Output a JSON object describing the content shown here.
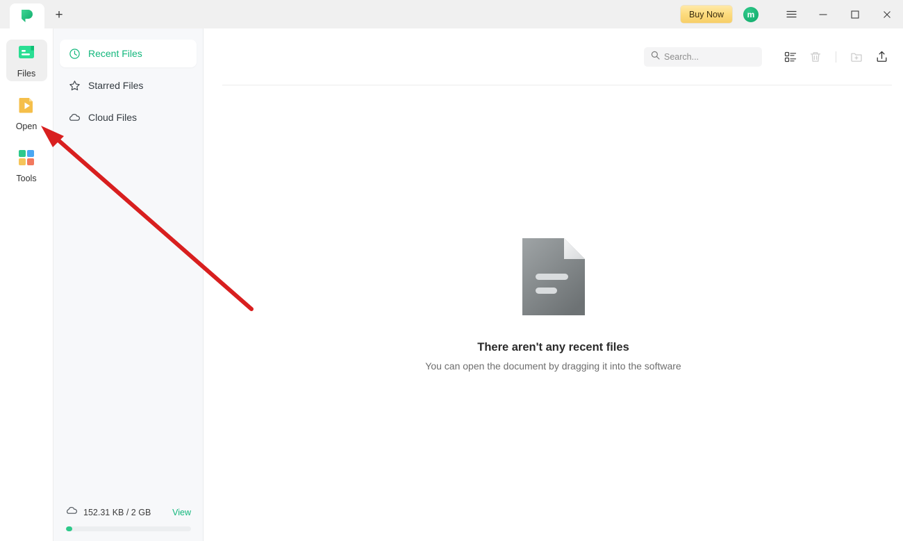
{
  "window": {
    "tab_logo_icon": "pdf-app-logo-icon",
    "new_tab_label": "+",
    "buy_now_label": "Buy Now",
    "avatar_initial": "m",
    "menu_icon": "hamburger-menu-icon",
    "minimize_icon": "minimize-icon",
    "maximize_icon": "maximize-icon",
    "close_icon": "close-icon"
  },
  "rail": {
    "items": [
      {
        "label": "Files",
        "icon": "files-icon",
        "active": true
      },
      {
        "label": "Open",
        "icon": "open-document-icon",
        "active": false
      },
      {
        "label": "Tools",
        "icon": "tools-grid-icon",
        "active": false
      }
    ]
  },
  "nav": {
    "items": [
      {
        "label": "Recent Files",
        "icon": "clock-icon",
        "active": true
      },
      {
        "label": "Starred Files",
        "icon": "star-icon",
        "active": false
      },
      {
        "label": "Cloud Files",
        "icon": "cloud-icon",
        "active": false
      }
    ]
  },
  "storage": {
    "icon": "cloud-icon",
    "usage_text": "152.31 KB / 2 GB",
    "view_label": "View",
    "used_percent": 1
  },
  "toolbar": {
    "search_placeholder": "Search...",
    "search_value": "",
    "search_icon": "search-icon",
    "view_toggle_icon": "list-view-icon",
    "delete_icon": "trash-icon",
    "new_folder_icon": "new-folder-icon",
    "upload_icon": "upload-icon"
  },
  "empty_state": {
    "icon": "empty-document-icon",
    "title": "There aren't any recent files",
    "subtitle": "You can open the document by dragging it into the software"
  },
  "annotation": {
    "arrow_color": "#d81f1f",
    "points_at": "Open"
  },
  "colors": {
    "accent_green": "#12b77c",
    "buy_now_gold": "#f7cf68",
    "annotation_red": "#d81f1f"
  }
}
